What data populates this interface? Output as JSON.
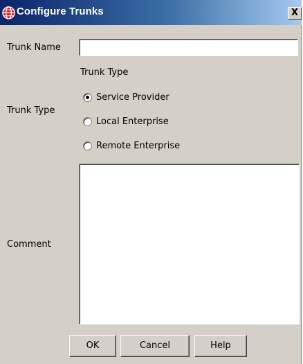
{
  "window": {
    "title": "Configure Trunks",
    "close_label": "X",
    "titlebar_colors": [
      "#0a246a",
      "#a6caf0"
    ],
    "background": "#d4d0c8"
  },
  "form": {
    "trunk_name": {
      "label": "Trunk Name",
      "value": ""
    },
    "trunk_type": {
      "label": "Trunk Type",
      "group_title": "Trunk Type",
      "options": [
        {
          "label": "Service Provider",
          "selected": true
        },
        {
          "label": "Local Enterprise",
          "selected": false
        },
        {
          "label": "Remote Enterprise",
          "selected": false
        }
      ]
    },
    "comment": {
      "label": "Comment",
      "value": ""
    }
  },
  "buttons": {
    "ok": "OK",
    "cancel": "Cancel",
    "help": "Help"
  },
  "icons": {
    "title_icon": "globe-icon"
  }
}
